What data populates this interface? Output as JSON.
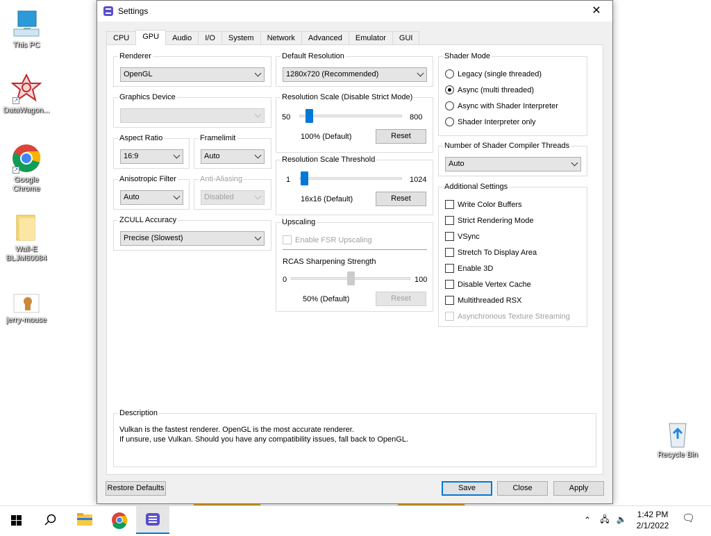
{
  "desktop": {
    "icons": [
      {
        "label": "This PC",
        "icon": "monitor-icon"
      },
      {
        "label": "DataWagon...",
        "icon": "wagon-logo-icon"
      },
      {
        "label": "Google Chrome",
        "icon": "chrome-icon"
      },
      {
        "label": "Wall-E BLJM60084",
        "icon": "folder-icon"
      },
      {
        "label": "jerry-mouse",
        "icon": "image-file-icon"
      },
      {
        "label": "Recycle Bin",
        "icon": "recycle-bin-icon"
      }
    ]
  },
  "window": {
    "title": "Settings",
    "close_glyph": "✕",
    "tabs": [
      "CPU",
      "GPU",
      "Audio",
      "I/O",
      "System",
      "Network",
      "Advanced",
      "Emulator",
      "GUI"
    ],
    "active_tab": "GPU"
  },
  "gpu": {
    "renderer": {
      "label": "Renderer",
      "value": "OpenGL"
    },
    "graphics_device": {
      "label": "Graphics Device",
      "value": ""
    },
    "aspect_ratio": {
      "label": "Aspect Ratio",
      "value": "16:9"
    },
    "framelimit": {
      "label": "Framelimit",
      "value": "Auto"
    },
    "anisotropic_filter": {
      "label": "Anisotropic Filter",
      "value": "Auto"
    },
    "anti_aliasing": {
      "label": "Anti-Aliasing",
      "value": "Disabled"
    },
    "zcull_accuracy": {
      "label": "ZCULL Accuracy",
      "value": "Precise (Slowest)"
    },
    "default_resolution": {
      "label": "Default Resolution",
      "value": "1280x720 (Recommended)"
    },
    "resolution_scale": {
      "label": "Resolution Scale (Disable Strict Mode)",
      "min": "50",
      "max": "800",
      "value_text": "100% (Default)",
      "reset": "Reset",
      "fraction": 0.067
    },
    "resolution_threshold": {
      "label": "Resolution Scale Threshold",
      "min": "1",
      "max": "1024",
      "value_text": "16x16 (Default)",
      "reset": "Reset",
      "fraction": 0.015
    },
    "upscaling": {
      "label": "Upscaling",
      "fsr": "Enable FSR Upscaling",
      "rcas_label": "RCAS Sharpening Strength",
      "min": "0",
      "max": "100",
      "value_text": "50% (Default)",
      "reset": "Reset",
      "fraction": 0.5
    },
    "shader_mode": {
      "label": "Shader Mode",
      "options": [
        "Legacy (single threaded)",
        "Async (multi threaded)",
        "Async with Shader Interpreter",
        "Shader Interpreter only"
      ],
      "selected": 1
    },
    "shader_threads": {
      "label": "Number of Shader Compiler Threads",
      "value": "Auto"
    },
    "additional": {
      "label": "Additional Settings",
      "items": [
        "Write Color Buffers",
        "Strict Rendering Mode",
        "VSync",
        "Stretch To Display Area",
        "Enable 3D",
        "Disable Vertex Cache",
        "Multithreaded RSX",
        "Asynchronous Texture Streaming"
      ]
    },
    "description": {
      "label": "Description",
      "line1": "Vulkan is the fastest renderer. OpenGL is the most accurate renderer.",
      "line2": "If unsure, use Vulkan. Should you have any compatibility issues, fall back to OpenGL."
    }
  },
  "buttons": {
    "restore": "Restore Defaults",
    "save": "Save",
    "close": "Close",
    "apply": "Apply"
  },
  "taskbar": {
    "time": "1:42 PM",
    "date": "2/1/2022"
  },
  "colors": {
    "accent": "#0078d7",
    "app_icon": "#5a50c8"
  }
}
